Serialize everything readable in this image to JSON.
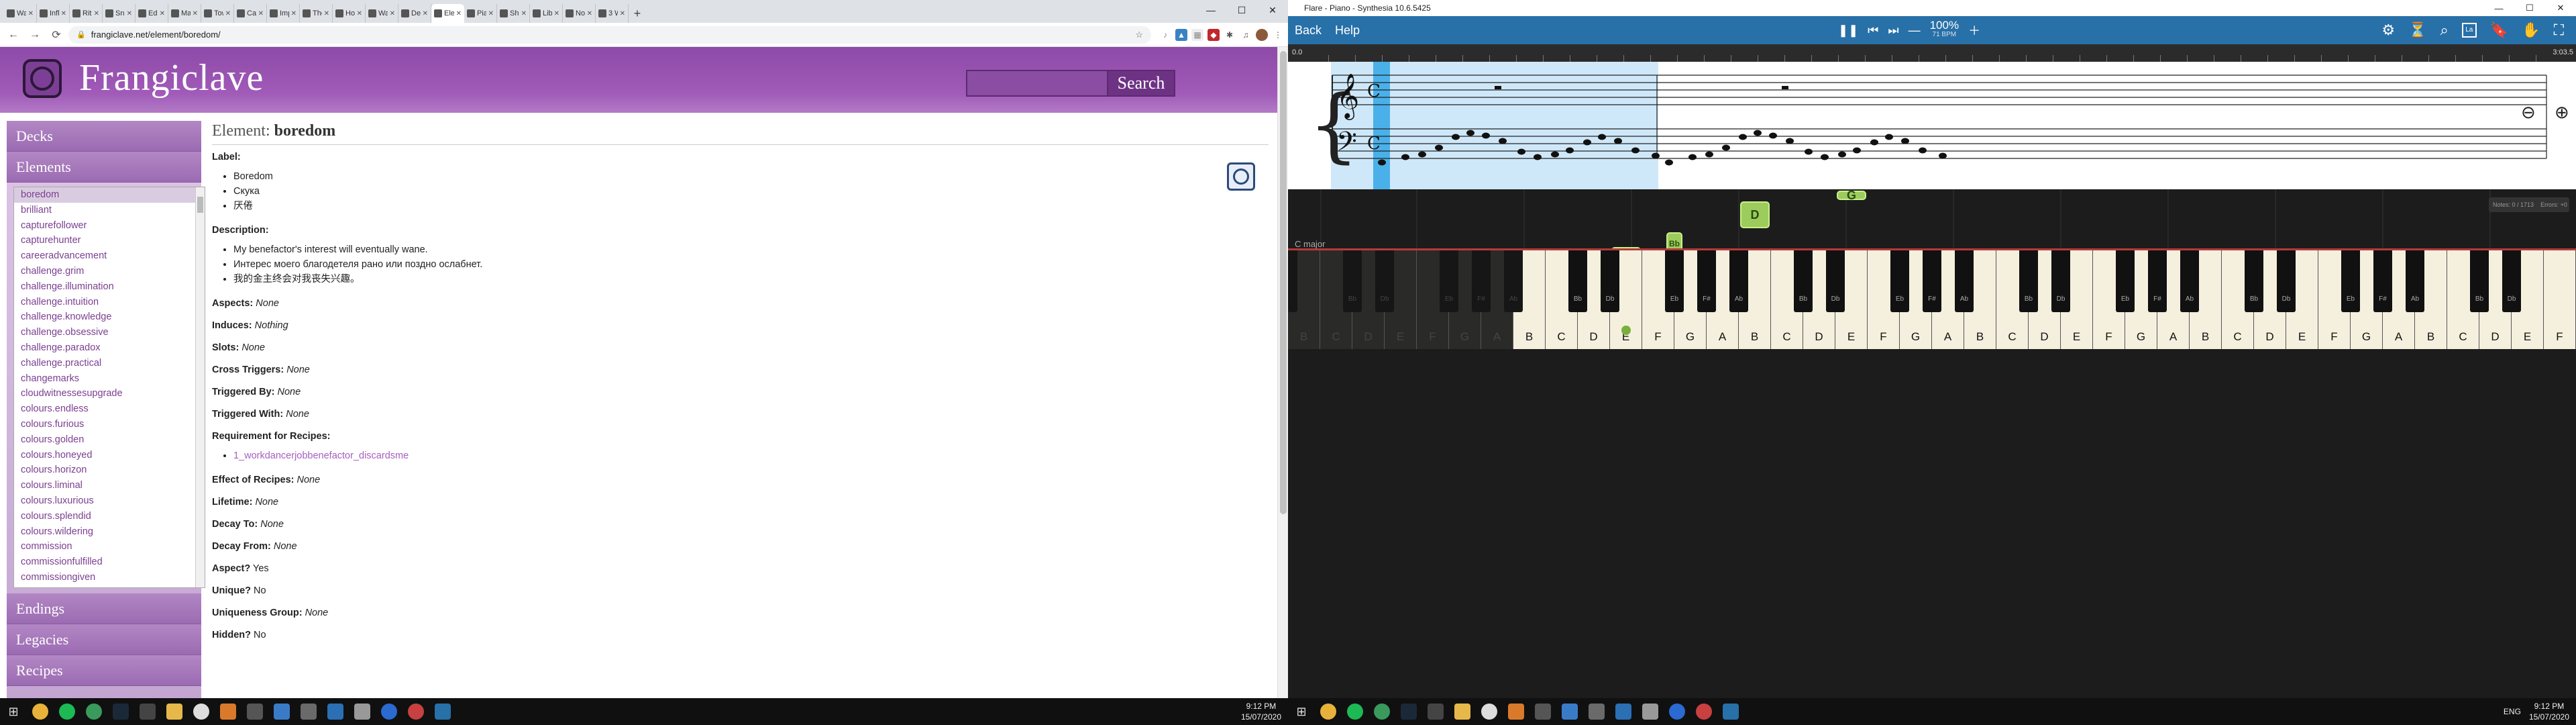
{
  "browser": {
    "tabs": [
      "Way",
      "Infl",
      "Ritu",
      "Sno",
      "Edg",
      "Mac",
      "Tow",
      "Cal",
      "Imp",
      "The",
      "Hou",
      "Way",
      "Dep",
      "Ele",
      "Pian",
      "Sha",
      "Lib",
      "Nor",
      "3 W"
    ],
    "active_tab_index": 13,
    "url": "frangiclave.net/element/boredom/"
  },
  "site": {
    "brand": "Frangiclave",
    "search_button": "Search",
    "search_placeholder": "",
    "nav": {
      "decks": "Decks",
      "elements": "Elements",
      "endings": "Endings",
      "legacies": "Legacies",
      "recipes": "Recipes"
    },
    "element_list": [
      "boredom",
      "brilliant",
      "capturefollower",
      "capturehunter",
      "careeradvancement",
      "challenge.grim",
      "challenge.illumination",
      "challenge.intuition",
      "challenge.knowledge",
      "challenge.obsessive",
      "challenge.paradox",
      "challenge.practical",
      "changemarks",
      "cloudwitnessesupgrade",
      "colours.endless",
      "colours.furious",
      "colours.golden",
      "colours.honeyed",
      "colours.horizon",
      "colours.liminal",
      "colours.luxurious",
      "colours.splendid",
      "colours.wildering",
      "commission",
      "commissionfulfilled",
      "commissiongiven"
    ],
    "element": {
      "title_prefix": "Element:",
      "title_id": "boredom",
      "label_key": "Label:",
      "labels": [
        "Boredom",
        "Скука",
        "厌倦"
      ],
      "description_key": "Description:",
      "descriptions": [
        "My benefactor's interest will eventually wane.",
        "Интерес моего благодетеля рано или поздно ослабнет.",
        "我的金主终会对我丧失兴趣。"
      ],
      "aspects_key": "Aspects:",
      "aspects_val": "None",
      "induces_key": "Induces:",
      "induces_val": "Nothing",
      "slots_key": "Slots:",
      "slots_val": "None",
      "cross_key": "Cross Triggers:",
      "cross_val": "None",
      "trigby_key": "Triggered By:",
      "trigby_val": "None",
      "trigwith_key": "Triggered With:",
      "trigwith_val": "None",
      "req_key": "Requirement for Recipes:",
      "req_link": "1_workdancerjobbenefactor_discardsme",
      "effect_key": "Effect of Recipes:",
      "effect_val": "None",
      "lifetime_key": "Lifetime:",
      "lifetime_val": "None",
      "decayto_key": "Decay To:",
      "decayto_val": "None",
      "decayfrom_key": "Decay From:",
      "decayfrom_val": "None",
      "aspectq_key": "Aspect?",
      "aspectq_val": "Yes",
      "unique_key": "Unique?",
      "unique_val": "No",
      "ugroup_key": "Uniqueness Group:",
      "ugroup_val": "None",
      "hidden_key": "Hidden?",
      "hidden_val": "No"
    }
  },
  "taskbar_left": {
    "time": "9:12 PM",
    "date": "15/07/2020"
  },
  "synthesia": {
    "window_title": "Flare - Piano - Synthesia 10.6.5425",
    "back": "Back",
    "help": "Help",
    "speed": "100%",
    "bpm": "71 BPM",
    "time_start": "0.0",
    "time_end": "3:03.5",
    "key_signature": "C major",
    "stats_notes_label": "Notes:",
    "stats_notes": "0 / 1713",
    "stats_errors_label": "Errors:",
    "stats_errors": "+0",
    "falling_notes": [
      {
        "label": "G",
        "key": 10
      },
      {
        "label": "Bb",
        "key": 12,
        "black": true
      },
      {
        "label": "D",
        "key": 14
      },
      {
        "label": "G",
        "key": 17
      }
    ],
    "white_keys": [
      "B",
      "C",
      "D",
      "E",
      "F",
      "G",
      "A",
      "B",
      "C",
      "D",
      "E",
      "F",
      "G",
      "A",
      "B",
      "C",
      "D",
      "E",
      "F",
      "G",
      "A",
      "B",
      "C",
      "D",
      "E",
      "F",
      "G",
      "A",
      "B",
      "C",
      "D",
      "E",
      "F",
      "G",
      "A",
      "B",
      "C",
      "D",
      "E",
      "F"
    ],
    "black_keys": [
      "Bb",
      "Db",
      "Eb",
      "F#",
      "Ab",
      "Bb",
      "Db",
      "Eb",
      "F#",
      "Ab",
      "Bb",
      "Db",
      "Eb",
      "F#",
      "Ab",
      "Bb",
      "Db",
      "Eb",
      "F#",
      "Ab",
      "Bb",
      "Db",
      "Eb",
      "F#",
      "Ab",
      "Bb",
      "Db",
      "Eb"
    ],
    "dim_white_count": 7,
    "dim_black_count": 5,
    "highlight_key_index": 10
  },
  "taskbar_right": {
    "time": "9:12 PM",
    "date": "15/07/2020",
    "lang": "ENG"
  },
  "colors": {
    "brand_purple": "#9a55b4",
    "synth_blue": "#2870a8",
    "note_green": "#9ccc5c"
  }
}
